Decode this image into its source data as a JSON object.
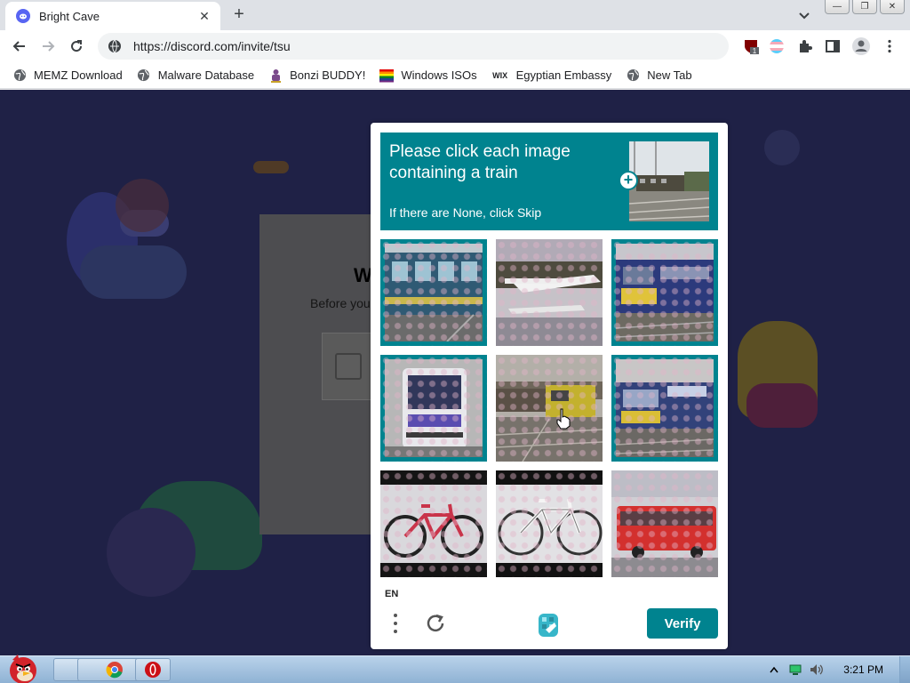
{
  "browser": {
    "tab_title": "Bright Cave",
    "url": "https://discord.com/invite/tsu",
    "bookmarks": [
      {
        "label": "MEMZ Download",
        "icon": "globe-icon"
      },
      {
        "label": "Malware Database",
        "icon": "globe-icon"
      },
      {
        "label": "Bonzi BUDDY!",
        "icon": "bonzi-icon"
      },
      {
        "label": "Windows ISOs",
        "icon": "windows-flag-icon"
      },
      {
        "label": "Egyptian Embassy",
        "icon": "wix-icon"
      },
      {
        "label": "New Tab",
        "icon": "globe-icon"
      }
    ],
    "extension_badge": "1"
  },
  "discord": {
    "welcome_text": "W",
    "before_text": "Before you"
  },
  "captcha": {
    "prompt_title": "Please click each image containing a train",
    "prompt_sub": "If there are None, click Skip",
    "language": "EN",
    "verify_label": "Verify",
    "accent_color": "#00838f",
    "tiles": [
      {
        "subject": "train",
        "selected": true
      },
      {
        "subject": "seaplane",
        "selected": false
      },
      {
        "subject": "train",
        "selected": true
      },
      {
        "subject": "bus",
        "selected": true
      },
      {
        "subject": "train",
        "selected": false
      },
      {
        "subject": "train",
        "selected": true
      },
      {
        "subject": "bicycle",
        "selected": false
      },
      {
        "subject": "bicycle",
        "selected": false
      },
      {
        "subject": "bus",
        "selected": false
      }
    ]
  },
  "taskbar": {
    "clock": "3:21 PM"
  }
}
